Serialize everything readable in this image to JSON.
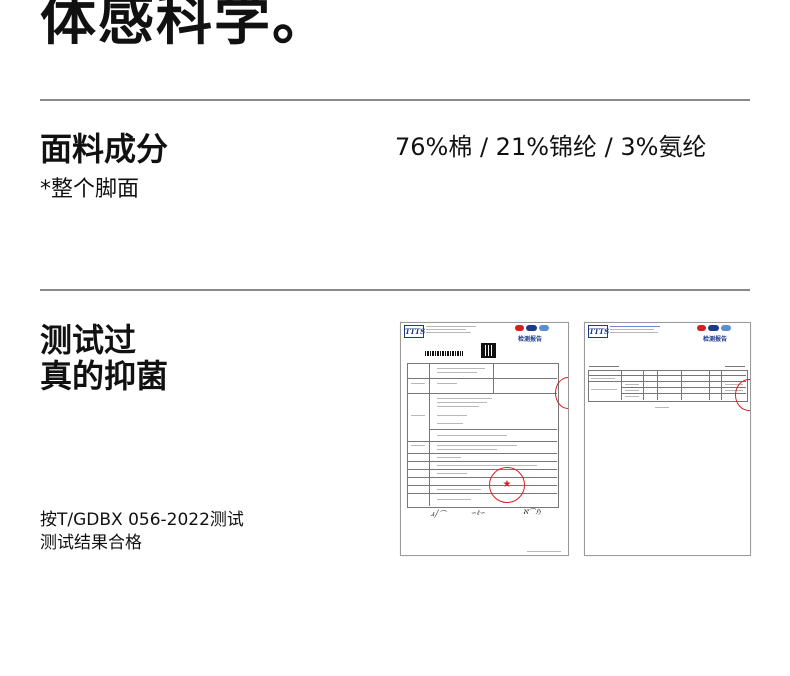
{
  "hero": {
    "text": "体感科学。"
  },
  "fabric": {
    "heading": "面料成分",
    "note": "*整个脚面",
    "composition": "76%棉 / 21%锦纶 / 3%氨纶"
  },
  "antibacterial": {
    "heading_line1": "测试过",
    "heading_line2": "真的抑菌",
    "standard_line1": "按T/GDBX 056-2022测试",
    "standard_line2": "测试结果合格"
  },
  "reports": [
    {
      "logo": "TTTS",
      "title": "检测报告"
    },
    {
      "logo": "TTTS",
      "title": "检测报告"
    }
  ],
  "colors": {
    "rule": "#8a8a8a",
    "stamp": "#d62020",
    "report_blue": "#1c3a8a"
  }
}
